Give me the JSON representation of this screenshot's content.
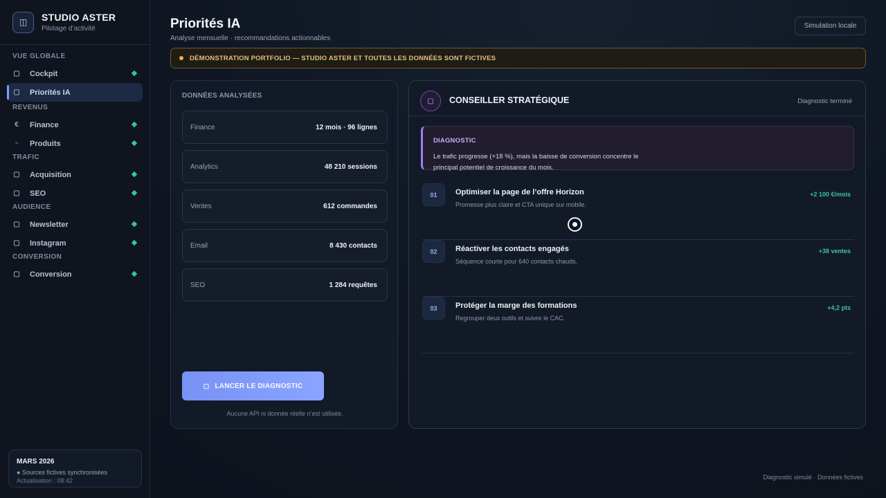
{
  "brand": {
    "icon": "◫",
    "name": "STUDIO ASTER",
    "subtitle": "Pilotage d’activité"
  },
  "sidebar": {
    "sections": [
      {
        "label": "VUE GLOBALE",
        "items": [
          {
            "label": "Cockpit",
            "icon": "▢",
            "status": true
          },
          {
            "label": "Priorités IA",
            "icon": "▢",
            "active": true
          }
        ]
      },
      {
        "label": "REVENUS",
        "items": [
          {
            "label": "Finance",
            "icon": "€",
            "status": true
          },
          {
            "label": "Produits",
            "icon": "▫",
            "status": true
          }
        ]
      },
      {
        "label": "TRAFIC",
        "items": [
          {
            "label": "Acquisition",
            "icon": "▢",
            "status": true
          },
          {
            "label": "SEO",
            "icon": "▢",
            "status": true
          }
        ]
      },
      {
        "label": "AUDIENCE",
        "items": [
          {
            "label": "Newsletter",
            "icon": "▢",
            "status": true
          },
          {
            "label": "Instagram",
            "icon": "▢",
            "status": true
          }
        ]
      },
      {
        "label": "CONVERSION",
        "items": [
          {
            "label": "Conversion",
            "icon": "▢",
            "status": true
          }
        ]
      }
    ],
    "footer": {
      "title": "MARS 2026",
      "line": "● Sources fictives synchronisées",
      "sub": "Actualisation : 08:42"
    }
  },
  "header": {
    "title": "Priorités IA",
    "subtitle": "Analyse mensuelle · recommandations actionnables",
    "sim_button": "Simulation locale"
  },
  "banner": {
    "text": "DÉMONSTRATION PORTFOLIO — STUDIO ASTER ET TOUTES LES DONNÉES SONT FICTIVES"
  },
  "data_panel": {
    "title": "DONNÉES ANALYSÉES",
    "sources": [
      {
        "label": "Finance",
        "value": "12 mois · 96 lignes"
      },
      {
        "label": "Analytics",
        "value": "48 210 sessions"
      },
      {
        "label": "Ventes",
        "value": "612 commandes"
      },
      {
        "label": "Email",
        "value": "8 430 contacts"
      },
      {
        "label": "SEO",
        "value": "1 284 requêtes"
      }
    ],
    "launch_icon": "▢",
    "launch_label": "LANCER LE DIAGNOSTIC",
    "note": "Aucune API ni donnée réelle n’est utilisée."
  },
  "advisor": {
    "icon": "▢",
    "title": "CONSEILLER STRATÉGIQUE",
    "status": "Diagnostic terminé",
    "diagnostic_title": "DIAGNOSTIC",
    "diagnostic_text": "Le trafic progresse (+18 %), mais la baisse de conversion concentre le principal potentiel de croissance du mois.",
    "recommendations": [
      {
        "num": "01",
        "title": "Optimiser la page de l’offre Horizon",
        "desc": "Promesse plus claire et CTA unique sur mobile.",
        "gain": "+2 100 €/mois"
      },
      {
        "num": "02",
        "title": "Réactiver les contacts engagés",
        "desc": "Séquence courte pour 640 contacts chauds.",
        "gain": "+38 ventes"
      },
      {
        "num": "03",
        "title": "Protéger la marge des formations",
        "desc": "Regrouper deux outils et suivre le CAC.",
        "gain": "+4,2 pts"
      }
    ]
  },
  "footer_note": "Diagnostic simulé · Données fictives",
  "colors": {
    "accent": "#7f9cf7",
    "status": "#39c39a",
    "warning": "#f2b23a",
    "advisor": "#9e82ef"
  }
}
